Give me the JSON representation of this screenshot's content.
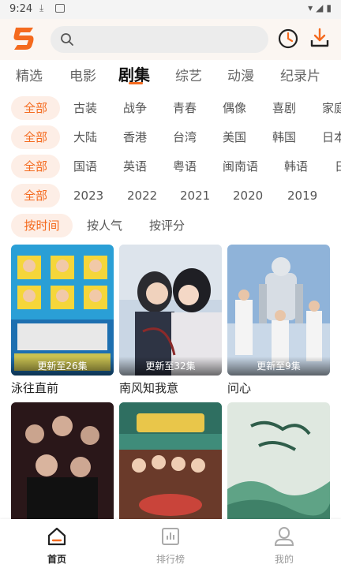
{
  "status_bar": {
    "time": "9:24"
  },
  "header": {
    "search_placeholder": "",
    "accent_color": "#f46a1e"
  },
  "nav_tabs": [
    {
      "label": "精选",
      "active": false
    },
    {
      "label": "电影",
      "active": false
    },
    {
      "label": "剧集",
      "active": true
    },
    {
      "label": "综艺",
      "active": false
    },
    {
      "label": "动漫",
      "active": false
    },
    {
      "label": "纪录片",
      "active": false
    }
  ],
  "filters": {
    "genre": {
      "selected": "全部",
      "options": [
        "古装",
        "战争",
        "青春",
        "偶像",
        "喜剧",
        "家庭"
      ]
    },
    "region": {
      "selected": "全部",
      "options": [
        "大陆",
        "香港",
        "台湾",
        "美国",
        "韩国",
        "日本"
      ]
    },
    "language": {
      "selected": "全部",
      "options": [
        "国语",
        "英语",
        "粤语",
        "闽南语",
        "韩语",
        "日语"
      ]
    },
    "year": {
      "selected": "全部",
      "options": [
        "2023",
        "2022",
        "2021",
        "2020",
        "2019"
      ]
    }
  },
  "sort": {
    "selected": "按时间",
    "options": [
      "按人气",
      "按评分"
    ]
  },
  "cards": [
    {
      "title": "泳往直前",
      "badge": "更新至26集"
    },
    {
      "title": "南风知我意",
      "badge": "更新至32集"
    },
    {
      "title": "问心",
      "badge": "更新至9集"
    },
    {
      "title": "",
      "badge": ""
    },
    {
      "title": "",
      "badge": ""
    },
    {
      "title": "",
      "badge": ""
    }
  ],
  "bottom_nav": [
    {
      "label": "首页",
      "icon": "home-icon",
      "active": true
    },
    {
      "label": "排行榜",
      "icon": "ranking-icon",
      "active": false
    },
    {
      "label": "我的",
      "icon": "profile-icon",
      "active": false
    }
  ]
}
